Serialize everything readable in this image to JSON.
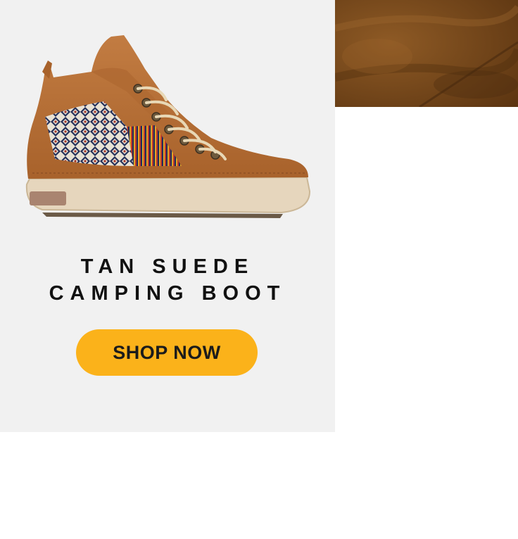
{
  "product": {
    "title_line1": "TAN SUEDE",
    "title_line2": "CAMPING BOOT",
    "image_icon": "boot-product-image",
    "accent_color": "#fbb21a",
    "boot_color": "#b5713a"
  },
  "cta": {
    "label": "SHOP NOW"
  },
  "swatch": {
    "icon": "suede-texture-swatch",
    "color": "#7a4a1c"
  }
}
